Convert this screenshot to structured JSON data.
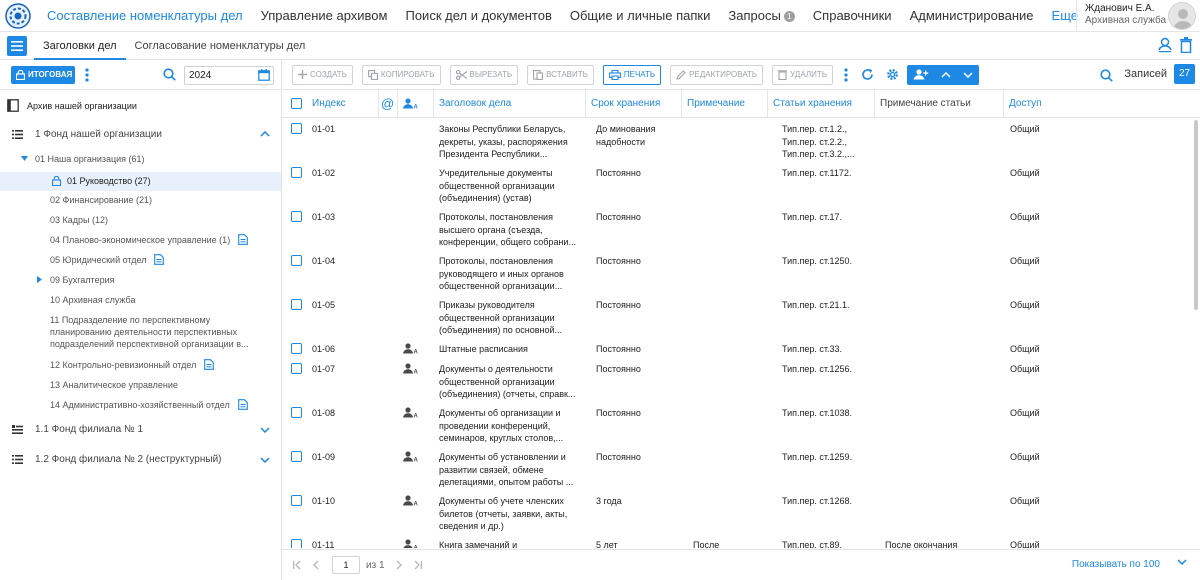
{
  "nav": {
    "items": [
      {
        "label": "Составление номенклатуры дел",
        "active": true
      },
      {
        "label": "Управление архивом"
      },
      {
        "label": "Поиск дел и документов"
      },
      {
        "label": "Общие и личные папки"
      },
      {
        "label": "Запросы",
        "badge": "1"
      },
      {
        "label": "Справочники"
      },
      {
        "label": "Администрирование"
      }
    ],
    "more_label": "Еще"
  },
  "user": {
    "name": "Жданович Е.А.",
    "role": "Архивная служба"
  },
  "tabs": [
    {
      "label": "Заголовки дел",
      "active": true
    },
    {
      "label": "Согласование номенклатуры дел"
    }
  ],
  "left_toolbar": {
    "final_label": "ИТОГОВАЯ",
    "year": "2024"
  },
  "tree": {
    "root": "Архив нашей организации",
    "fonds": [
      {
        "label": "1 Фонд нашей организации"
      },
      {
        "label": "1.1 Фонд филиала № 1"
      },
      {
        "label": "1.2 Фонд филиала № 2 (неструктурный)"
      }
    ],
    "org": "01 Наша организация (61)",
    "departments": [
      {
        "label": "01 Руководство (27)"
      },
      {
        "label": "02 Финансирование (21)"
      },
      {
        "label": "03 Кадры (12)"
      },
      {
        "label": "04 Планово-экономическое управление (1)"
      },
      {
        "label": "05 Юридический отдел"
      },
      {
        "label": "09 Бухгалтерия"
      },
      {
        "label": "10 Архивная служба"
      },
      {
        "lines": [
          "11 Подразделение по перспективному",
          "планированию деятельности перспективных",
          "подразделений перспективной организации в..."
        ]
      },
      {
        "label": "12 Контрольно-ревизионный отдел"
      },
      {
        "label": "13 Аналитическое управление"
      },
      {
        "label": "14 Административно-хозяйственный отдел"
      }
    ]
  },
  "toolbar": {
    "create": "СОЗДАТЬ",
    "copy": "КОПИРОВАТЬ",
    "cut": "ВЫРЕЗАТЬ",
    "paste": "ВСТАВИТЬ",
    "print": "ПЕЧАТЬ",
    "edit": "РЕДАКТИРОВАТЬ",
    "delete": "УДАЛИТЬ",
    "records_label": "Записей",
    "records_count": "27"
  },
  "table": {
    "columns": {
      "index": "Индекс",
      "at": "@",
      "title": "Заголовок дела",
      "term": "Срок хранения",
      "note": "Примечание",
      "articles": "Статьи хранения",
      "article_note": "Примечание статьи",
      "access": "Доступ"
    },
    "rows": [
      {
        "index": "01-01",
        "person": false,
        "title": [
          "Законы Республики Беларусь,",
          "декреты, указы, распоряжения",
          "Президента Республики..."
        ],
        "term": [
          "До минования",
          "надобности"
        ],
        "note": [],
        "articles": [
          "Тип.пер. ст.1.2.,",
          "Тип.пер. ст.2.2.,",
          "Тип.пер. ст.3.2.,..."
        ],
        "article_note": [],
        "access": "Общий"
      },
      {
        "index": "01-02",
        "person": false,
        "title": [
          "Учредительные документы",
          "общественной организации",
          "(объединения) (устав)"
        ],
        "term": [
          "Постоянно"
        ],
        "note": [],
        "articles": [
          "Тип.пер. ст.1172."
        ],
        "article_note": [],
        "access": "Общий"
      },
      {
        "index": "01-03",
        "person": false,
        "title": [
          "Протоколы, постановления",
          "высшего органа (съезда,",
          "конференции, общего собрани..."
        ],
        "term": [
          "Постоянно"
        ],
        "note": [],
        "articles": [
          "Тип.пер. ст.17."
        ],
        "article_note": [],
        "access": "Общий"
      },
      {
        "index": "01-04",
        "person": false,
        "title": [
          "Протоколы, постановления",
          "руководящего и иных органов",
          "общественной организации..."
        ],
        "term": [
          "Постоянно"
        ],
        "note": [],
        "articles": [
          "Тип.пер. ст.1250."
        ],
        "article_note": [],
        "access": "Общий"
      },
      {
        "index": "01-05",
        "person": false,
        "title": [
          "Приказы руководителя",
          "общественной организации",
          "(объединения) по основной..."
        ],
        "term": [
          "Постоянно"
        ],
        "note": [],
        "articles": [
          "Тип.пер. ст.21.1."
        ],
        "article_note": [],
        "access": "Общий"
      },
      {
        "index": "01-06",
        "person": true,
        "title": [
          "Штатные расписания"
        ],
        "term": [
          "Постоянно"
        ],
        "note": [],
        "articles": [
          "Тип.пер. ст.33."
        ],
        "article_note": [],
        "access": "Общий"
      },
      {
        "index": "01-07",
        "person": true,
        "title": [
          "Документы о деятельности",
          "общественной организации",
          "(объединения) (отчеты, справк..."
        ],
        "term": [
          "Постоянно"
        ],
        "note": [],
        "articles": [
          "Тип.пер. ст.1256."
        ],
        "article_note": [],
        "access": "Общий"
      },
      {
        "index": "01-08",
        "person": true,
        "title": [
          "Документы об организации и",
          "проведении конференций,",
          "семинаров, круглых столов,..."
        ],
        "term": [
          "Постоянно"
        ],
        "note": [],
        "articles": [
          "Тип.пер. ст.1038."
        ],
        "article_note": [],
        "access": "Общий"
      },
      {
        "index": "01-09",
        "person": true,
        "title": [
          "Документы об установлении и",
          "развитии связей, обмене",
          "делегациями, опытом работы ..."
        ],
        "term": [
          "Постоянно"
        ],
        "note": [],
        "articles": [
          "Тип.пер. ст.1259."
        ],
        "article_note": [],
        "access": "Общий"
      },
      {
        "index": "01-10",
        "person": true,
        "title": [
          "Документы об учете членских",
          "билетов (отчеты, заявки, акты,",
          "сведения и др.)"
        ],
        "term": [
          "3 года"
        ],
        "note": [],
        "articles": [
          "Тип.пер. ст.1268."
        ],
        "article_note": [],
        "access": "Общий"
      },
      {
        "index": "01-11",
        "person": true,
        "title": [
          "Книга замечаний и"
        ],
        "term": [
          "5 лет"
        ],
        "note": [
          "После"
        ],
        "articles": [
          "Тип.пер. ст.89."
        ],
        "article_note": [
          "После окончания"
        ],
        "access": "Общий"
      }
    ]
  },
  "footer": {
    "page": "1",
    "of": "из 1",
    "show": "Показывать по 100"
  },
  "colors": {
    "accent": "#1e88e5"
  }
}
